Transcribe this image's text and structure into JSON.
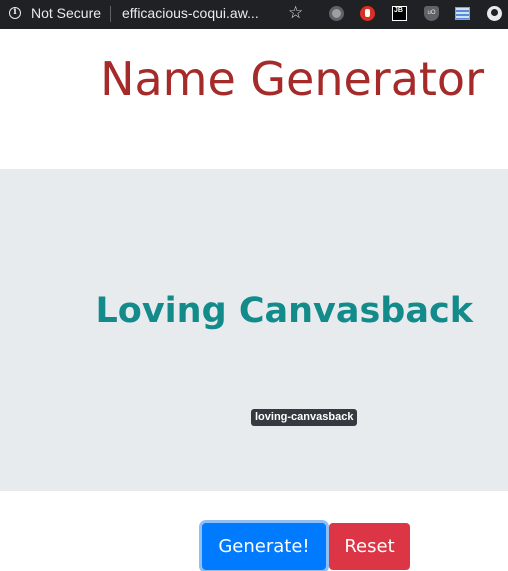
{
  "browser": {
    "security_label": "Not Secure",
    "url": "efficacious-coqui.aw...",
    "info_glyph": "i",
    "star_glyph": "☆",
    "extensions": [
      "record-icon",
      "block-icon",
      "jb-icon",
      "ublock-icon",
      "flag-icon",
      "bulb-icon"
    ],
    "jb_label": "JB",
    "ublock_label": "uO"
  },
  "page": {
    "title": "Name Generator",
    "generated_name": "Loving Canvasback",
    "slug": "loving-canvasback"
  },
  "actions": {
    "generate_label": "Generate!",
    "reset_label": "Reset"
  },
  "colors": {
    "title": "#a52a2a",
    "name": "#138b8b",
    "jumbotron_bg": "#e8ebee",
    "generate_bg": "#007bff",
    "reset_bg": "#dc3545",
    "badge_bg": "#343a40"
  }
}
